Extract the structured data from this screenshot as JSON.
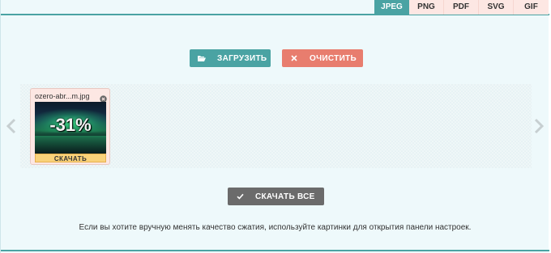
{
  "tabs": [
    {
      "label": "JPEG",
      "active": true
    },
    {
      "label": "PNG",
      "active": false
    },
    {
      "label": "PDF",
      "active": false
    },
    {
      "label": "SVG",
      "active": false
    },
    {
      "label": "GIF",
      "active": false
    }
  ],
  "actions": {
    "upload_label": "ЗАГРУЗИТЬ",
    "upload_icon": "folder-open-icon",
    "clear_label": "ОЧИСТИТЬ",
    "clear_icon": "x-icon",
    "download_all_label": "СКАЧАТЬ ВСЕ",
    "download_all_icon": "check-icon"
  },
  "files": [
    {
      "name": "ozero-abr...m.jpg",
      "reduction": "-31%",
      "download_label": "СКАЧАТЬ"
    }
  ],
  "hint_text": "Если вы хотите вручную менять качество сжатия, используйте картинки для открытия панели настроек.",
  "colors": {
    "accent": "#4aa3a3",
    "clear": "#e87d6e",
    "download_all": "#6b6b6b",
    "tab_inactive": "#fde7e3",
    "card_download": "#f9d27a"
  }
}
